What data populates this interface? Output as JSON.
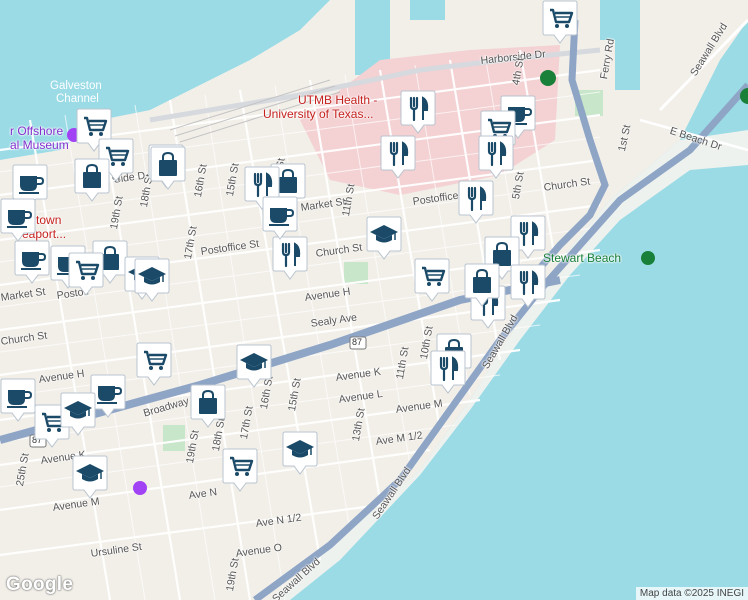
{
  "map": {
    "colors": {
      "land": "#f2efe9",
      "water": "#9adbe6",
      "hospital": "#f4d1d3",
      "park": "#c8e6c9",
      "highway": "#8ea5c6",
      "road": "#ffffff",
      "pin": "#ffffff",
      "pin_icon": "#1b4a68"
    },
    "water_labels": [
      "Galveston",
      "Channel"
    ],
    "places": [
      {
        "id": "utmb",
        "lines": [
          "UTMB Health -",
          "University of Texas..."
        ]
      },
      {
        "id": "offshore",
        "lines": [
          "r Offshore",
          "al Museum"
        ]
      },
      {
        "id": "downtown",
        "lines": [
          "owntown",
          "Seaport..."
        ]
      },
      {
        "id": "stewart-beach",
        "lines": [
          "Stewart Beach"
        ]
      }
    ],
    "streets": [
      "Harborside Dr",
      "Ferry Rd",
      "Seawall Blvd",
      "Seawall Blvd",
      "Seawall Blvd",
      "Seawall Blvd",
      "1st St",
      "E Beach Dr",
      "4th St",
      "5th St",
      "Church St",
      "Postoffice St",
      "Postoffice St",
      "Market St",
      "11th St",
      "13th St",
      "15th St",
      "16th St",
      "17th St",
      "18th St",
      "19th St",
      "Church St",
      "Avenue H",
      "Sealy Ave",
      "Avenue K",
      "11th St",
      "10th St",
      "Avenue L",
      "Avenue M",
      "Ave M 1/2",
      "13th St",
      "15th St",
      "16th St",
      "17th St",
      "18th St",
      "19th St",
      "Broadway Ave",
      "Avenue H",
      "Church St",
      "Ave N 1/2",
      "Avenue O",
      "Ursuline St",
      "Avenue M",
      "25th St",
      "19th St",
      "Ave N",
      "Avenue K",
      "Market St",
      "Postoff",
      "Side D",
      "19th St"
    ],
    "route_shields": [
      "87",
      "87"
    ],
    "attribution": "Map data ©2025 INEGI",
    "logo": "Google"
  },
  "pins": [
    {
      "type": "shopping-cart-icon"
    },
    {
      "type": "restaurant-icon"
    },
    {
      "type": "coffee-icon"
    },
    {
      "type": "shopping-cart-icon"
    },
    {
      "type": "restaurant-icon"
    },
    {
      "type": "restaurant-icon"
    },
    {
      "type": "restaurant-icon"
    },
    {
      "type": "shopping-cart-icon"
    },
    {
      "type": "restaurant-icon"
    },
    {
      "type": "restaurant-icon"
    },
    {
      "type": "school-icon"
    },
    {
      "type": "shopping-cart-icon"
    },
    {
      "type": "shopping-bag-icon"
    },
    {
      "type": "restaurant-icon"
    },
    {
      "type": "restaurant-icon"
    },
    {
      "type": "shopping-bag-icon"
    },
    {
      "type": "shopping-bag-icon"
    },
    {
      "type": "restaurant-icon"
    },
    {
      "type": "shopping-bag-icon"
    },
    {
      "type": "restaurant-icon"
    },
    {
      "type": "coffee-icon"
    },
    {
      "type": "restaurant-icon"
    },
    {
      "type": "shopping-bag-icon"
    },
    {
      "type": "shopping-cart-icon"
    },
    {
      "type": "shopping-cart-icon"
    },
    {
      "type": "shopping-bag-icon"
    },
    {
      "type": "coffee-icon"
    },
    {
      "type": "coffee-icon"
    },
    {
      "type": "coffee-icon"
    },
    {
      "type": "coffee-icon"
    },
    {
      "type": "shopping-bag-icon"
    },
    {
      "type": "shopping-cart-icon"
    },
    {
      "type": "school-icon"
    },
    {
      "type": "school-icon"
    },
    {
      "type": "shopping-cart-icon"
    },
    {
      "type": "school-icon"
    },
    {
      "type": "coffee-icon"
    },
    {
      "type": "coffee-icon"
    },
    {
      "type": "shopping-bag-icon"
    },
    {
      "type": "shopping-cart-icon"
    },
    {
      "type": "school-icon"
    },
    {
      "type": "school-icon"
    },
    {
      "type": "shopping-cart-icon"
    },
    {
      "type": "school-icon"
    }
  ]
}
